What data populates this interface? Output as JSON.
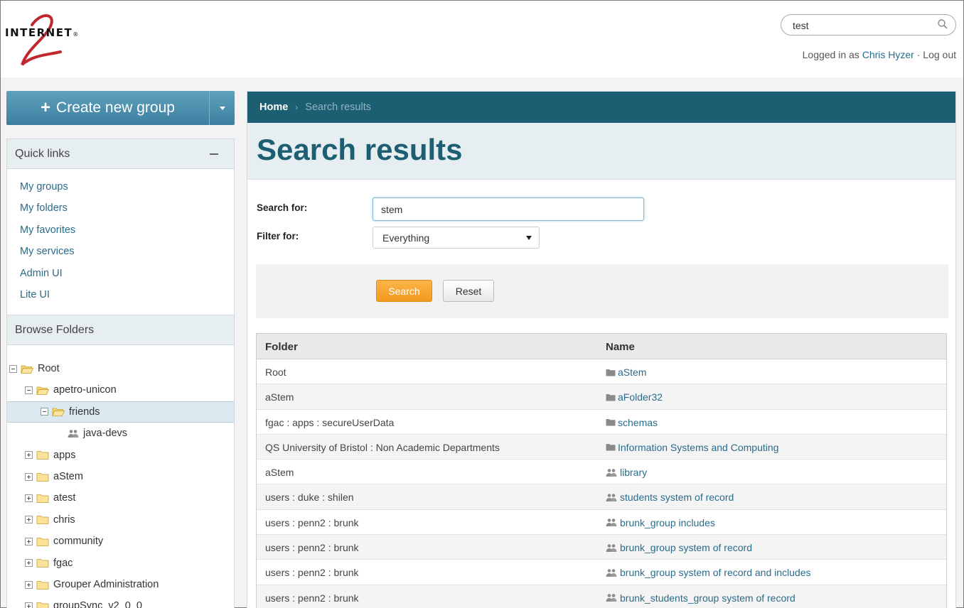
{
  "logo": {
    "text": "INTERNET",
    "mark": "®"
  },
  "header": {
    "search_value": "test",
    "login_prefix": "Logged in as",
    "user_name": "Chris Hyzer",
    "separator": "·",
    "logout": "Log out"
  },
  "sidebar": {
    "create_label": "Create new group",
    "quick_links": {
      "title": "Quick links",
      "items": [
        "My groups",
        "My folders",
        "My favorites",
        "My services",
        "Admin UI",
        "Lite UI"
      ]
    },
    "browse": {
      "title": "Browse Folders",
      "tree": [
        {
          "label": "Root",
          "level": 0,
          "type": "folder-open",
          "toggle": "minus"
        },
        {
          "label": "apetro-unicon",
          "level": 1,
          "type": "folder-open",
          "toggle": "minus"
        },
        {
          "label": "friends",
          "level": 2,
          "type": "folder-open",
          "toggle": "minus",
          "selected": true
        },
        {
          "label": "java-devs",
          "level": 3,
          "type": "group",
          "toggle": "none"
        },
        {
          "label": "apps",
          "level": 1,
          "type": "folder",
          "toggle": "plus"
        },
        {
          "label": "aStem",
          "level": 1,
          "type": "folder",
          "toggle": "plus"
        },
        {
          "label": "atest",
          "level": 1,
          "type": "folder",
          "toggle": "plus"
        },
        {
          "label": "chris",
          "level": 1,
          "type": "folder",
          "toggle": "plus"
        },
        {
          "label": "community",
          "level": 1,
          "type": "folder",
          "toggle": "plus"
        },
        {
          "label": "fgac",
          "level": 1,
          "type": "folder",
          "toggle": "plus"
        },
        {
          "label": "Grouper Administration",
          "level": 1,
          "type": "folder",
          "toggle": "plus"
        },
        {
          "label": "groupSync_v2_0_0",
          "level": 1,
          "type": "folder",
          "toggle": "plus"
        }
      ]
    }
  },
  "breadcrumb": {
    "home": "Home",
    "sep": "›",
    "current": "Search results"
  },
  "page_title": "Search results",
  "form": {
    "search_label": "Search for:",
    "search_value": "stem",
    "filter_label": "Filter for:",
    "filter_value": "Everything",
    "search_button": "Search",
    "reset_button": "Reset"
  },
  "results": {
    "columns": [
      "Folder",
      "Name"
    ],
    "rows": [
      {
        "folder": "Root",
        "name": "aStem",
        "icon": "folder-icon"
      },
      {
        "folder": "aStem",
        "name": "aFolder32",
        "icon": "folder-icon"
      },
      {
        "folder": "fgac : apps : secureUserData",
        "name": "schemas",
        "icon": "folder-icon"
      },
      {
        "folder": "QS University of Bristol : Non Academic Departments",
        "name": "Information Systems and Computing",
        "icon": "folder-icon"
      },
      {
        "folder": "aStem",
        "name": "library",
        "icon": "group-icon"
      },
      {
        "folder": "users : duke : shilen",
        "name": "students system of record",
        "icon": "group-icon"
      },
      {
        "folder": "users : penn2 : brunk",
        "name": "brunk_group includes",
        "icon": "group-icon"
      },
      {
        "folder": "users : penn2 : brunk",
        "name": "brunk_group system of record",
        "icon": "group-icon"
      },
      {
        "folder": "users : penn2 : brunk",
        "name": "brunk_group system of record and includes",
        "icon": "group-icon"
      },
      {
        "folder": "users : penn2 : brunk",
        "name": "brunk_students_group system of record",
        "icon": "group-icon"
      }
    ]
  },
  "colors": {
    "teal": "#1d5f72",
    "accent": "#f39a1d",
    "link": "#2a6b8a"
  }
}
